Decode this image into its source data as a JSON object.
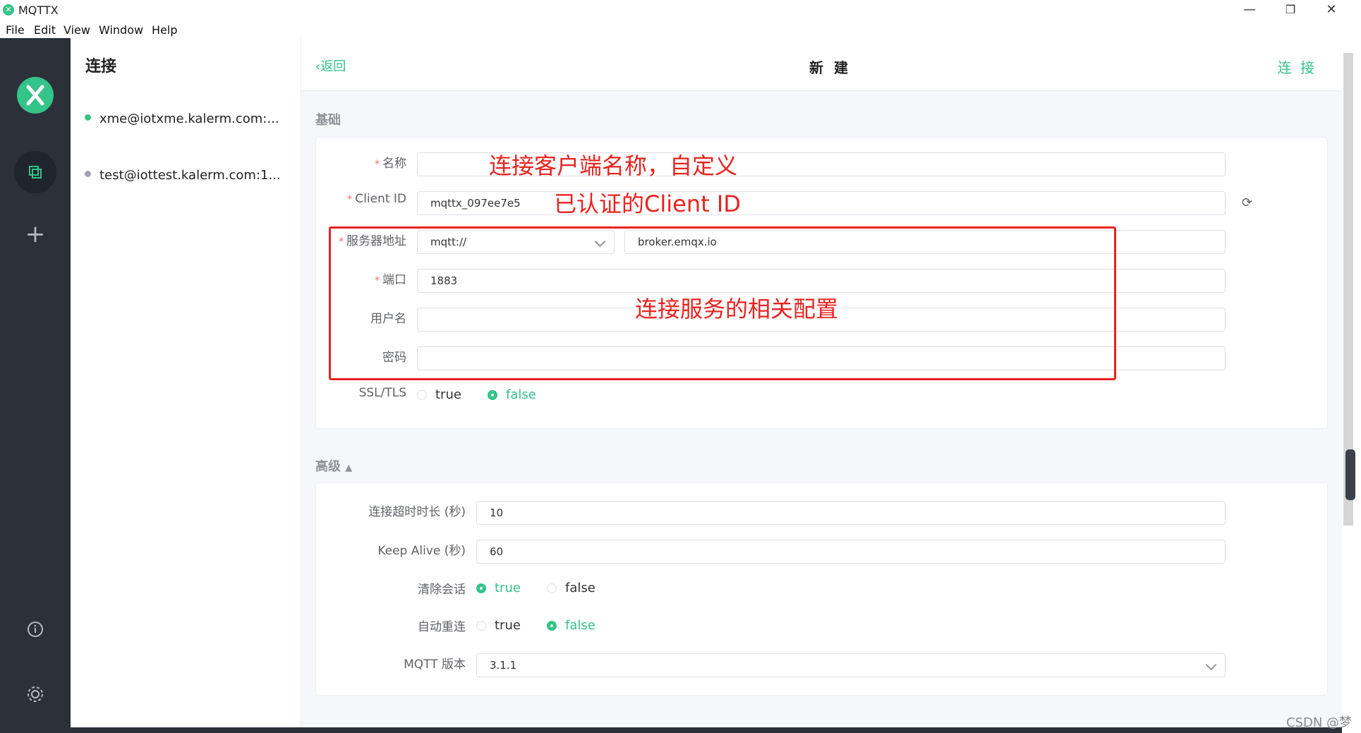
{
  "window": {
    "title": "MQTTX"
  },
  "menu": [
    "File",
    "Edit",
    "View",
    "Window",
    "Help"
  ],
  "connections": {
    "title": "连接",
    "items": [
      {
        "name": "xme@iotxme.kalerm.com:...",
        "color": "#34c388"
      },
      {
        "name": "test@iottest.kalerm.com:1...",
        "color": "#a0a4ab"
      }
    ]
  },
  "header": {
    "back": "返回",
    "title": "新 建",
    "connect": "连 接"
  },
  "basic": {
    "title": "基础",
    "name_label": "名称",
    "name_value": "",
    "client_id_label": "Client ID",
    "client_id_value": "mqttx_097ee7e5",
    "host_label": "服务器地址",
    "protocol_value": "mqtt://",
    "host_value": "broker.emqx.io",
    "port_label": "端口",
    "port_value": "1883",
    "username_label": "用户名",
    "username_value": "",
    "password_label": "密码",
    "password_value": "",
    "ssl_label": "SSL/TLS",
    "ssl_true": "true",
    "ssl_false": "false"
  },
  "advanced": {
    "title": "高级",
    "timeout_label": "连接超时时长 (秒)",
    "timeout_value": "10",
    "keepalive_label": "Keep Alive (秒)",
    "keepalive_value": "60",
    "clean_label": "清除会话",
    "clean_true": "true",
    "clean_false": "false",
    "reconnect_label": "自动重连",
    "reconnect_true": "true",
    "reconnect_false": "false",
    "version_label": "MQTT 版本",
    "version_value": "3.1.1"
  },
  "annotations": {
    "name_note": "连接客户端名称，自定义",
    "client_note": "已认证的Client ID",
    "server_note": "连接服务的相关配置"
  },
  "watermark": "CSDN @梦",
  "colors": {
    "accent": "#34c388",
    "annotation": "#e8231f",
    "sidebar": "#2b3039"
  }
}
